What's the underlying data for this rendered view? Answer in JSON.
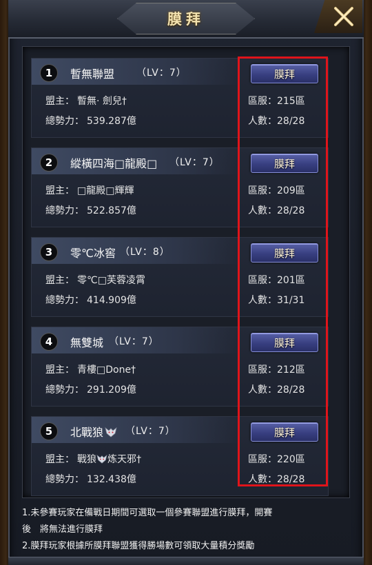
{
  "header": {
    "title": "膜拜"
  },
  "icons": {
    "close": "close-x-icon"
  },
  "colors": {
    "highlight": "#e0141a",
    "button": "#383f80"
  },
  "labels": {
    "leader": "盟主：",
    "power": "總勢力：",
    "server": "區服：",
    "members": "人數：",
    "worship": "膜拜"
  },
  "alliances": [
    {
      "rank": "1",
      "name": "暫無聯盟",
      "level": "（LV：7）",
      "leader": "暫無· 劍兒†",
      "power": "539.287億",
      "server": "215區",
      "members": "28/28"
    },
    {
      "rank": "2",
      "name": "縱橫四海□龍殿□",
      "level": "（LV：7）",
      "leader": "□龍殿□輝輝",
      "power": "522.857億",
      "server": "209區",
      "members": "28/28"
    },
    {
      "rank": "3",
      "name": "零℃冰窖",
      "level": "（LV：8）",
      "leader": "零℃□芙蓉凌霄",
      "power": "414.909億",
      "server": "201區",
      "members": "31/31"
    },
    {
      "rank": "4",
      "name": "無雙城",
      "level": "（LV：7）",
      "leader": "青樓□Done†",
      "power": "291.209億",
      "server": "212區",
      "members": "28/28"
    },
    {
      "rank": "5",
      "name": "北戰狼",
      "level": "（LV：7）",
      "leader": "戰狼",
      "leader_suffix": "炼天邪†",
      "power": "132.438億",
      "server": "220區",
      "members": "28/28"
    }
  ],
  "notes": {
    "line1": "1.未參賽玩家在備戰日期間可選取一個參賽聯盟進行膜拜，開賽",
    "line2": "後　將無法進行膜拜",
    "line3": "2.膜拜玩家根據所膜拜聯盟獲得勝場數可領取大量積分獎勵"
  }
}
